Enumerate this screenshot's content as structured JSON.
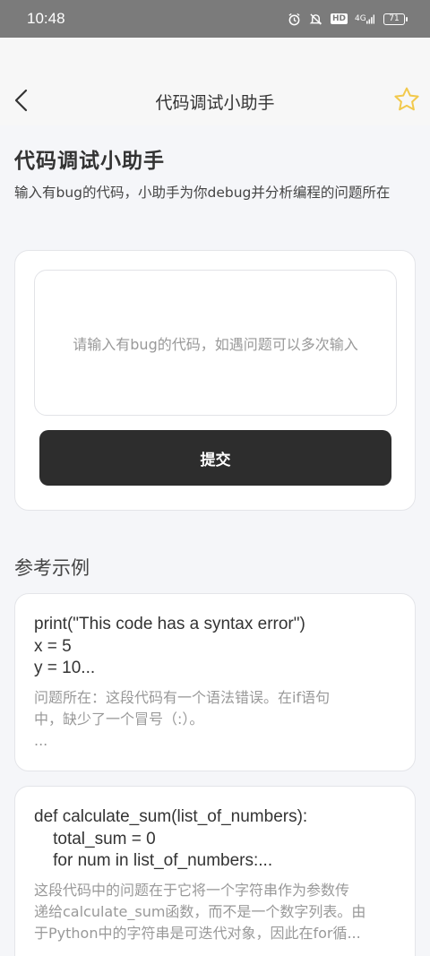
{
  "status_bar": {
    "time": "10:48",
    "icons": [
      "alarm-icon",
      "mute-icon",
      "hd-icon",
      "4g-icon",
      "signal-icon",
      "battery-icon"
    ],
    "hd_label": "HD",
    "network_label": "4G",
    "battery_level": "71"
  },
  "nav": {
    "title": "代码调试小助手",
    "back_icon": "chevron-left-icon",
    "favorite_icon": "star-icon",
    "accent_color": "#f2c94c"
  },
  "page": {
    "title": "代码调试小助手",
    "description": "输入有bug的代码，小助手为你debug并分析编程的问题所在"
  },
  "input": {
    "placeholder": "请输入有bug的代码，如遇问题可以多次输入",
    "value": ""
  },
  "submit": {
    "label": "提交"
  },
  "examples": {
    "title": "参考示例",
    "items": [
      {
        "code": "print(\"This code has a syntax error\")\nx = 5\ny = 10...",
        "explanation_lines": [
          "问题所在：这段代码有一个语法错误。在if语句",
          "中，缺少了一个冒号（:）。",
          "..."
        ]
      },
      {
        "code": "def calculate_sum(list_of_numbers):\n    total_sum = 0\n    for num in list_of_numbers:...",
        "explanation_lines": [
          "这段代码中的问题在于它将一个字符串作为参数传",
          "递给calculate_sum函数，而不是一个数字列表。由",
          "于Python中的字符串是可迭代对象，因此在for循..."
        ]
      }
    ]
  }
}
